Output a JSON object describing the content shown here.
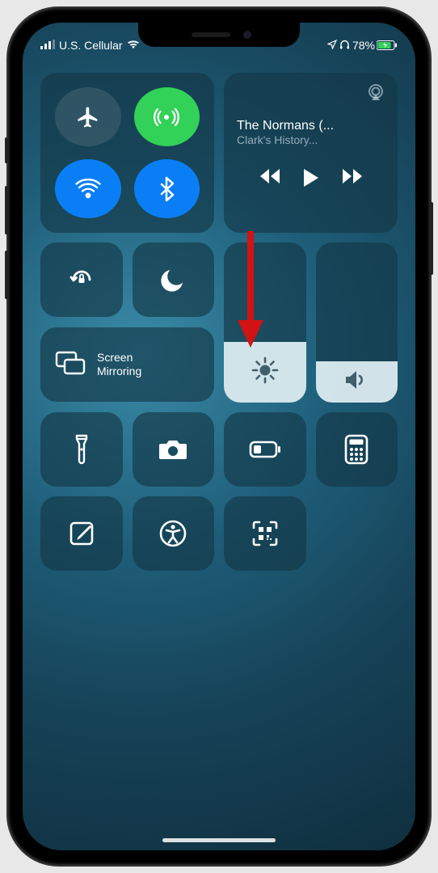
{
  "status": {
    "carrier": "U.S. Cellular",
    "battery_pct": "78%"
  },
  "connectivity": {
    "airplane_label": "Airplane Mode",
    "cellular_label": "Cellular Data",
    "wifi_label": "Wi-Fi",
    "bluetooth_label": "Bluetooth"
  },
  "media": {
    "title": "The Normans (...",
    "subtitle": "Clark's History..."
  },
  "toggles": {
    "orientation_lock": "Orientation Lock",
    "do_not_disturb": "Do Not Disturb"
  },
  "screen_mirroring": {
    "line1": "Screen",
    "line2": "Mirroring"
  },
  "sliders": {
    "brightness_pct": 38,
    "volume_pct": 26
  },
  "shortcuts": {
    "flashlight": "Flashlight",
    "camera": "Camera",
    "low_power": "Low Power Mode",
    "calculator": "Calculator",
    "notes": "Notes",
    "accessibility": "Accessibility",
    "qr_scanner": "QR Code Scanner"
  },
  "annotation": {
    "arrow": "drag-down-arrow"
  }
}
